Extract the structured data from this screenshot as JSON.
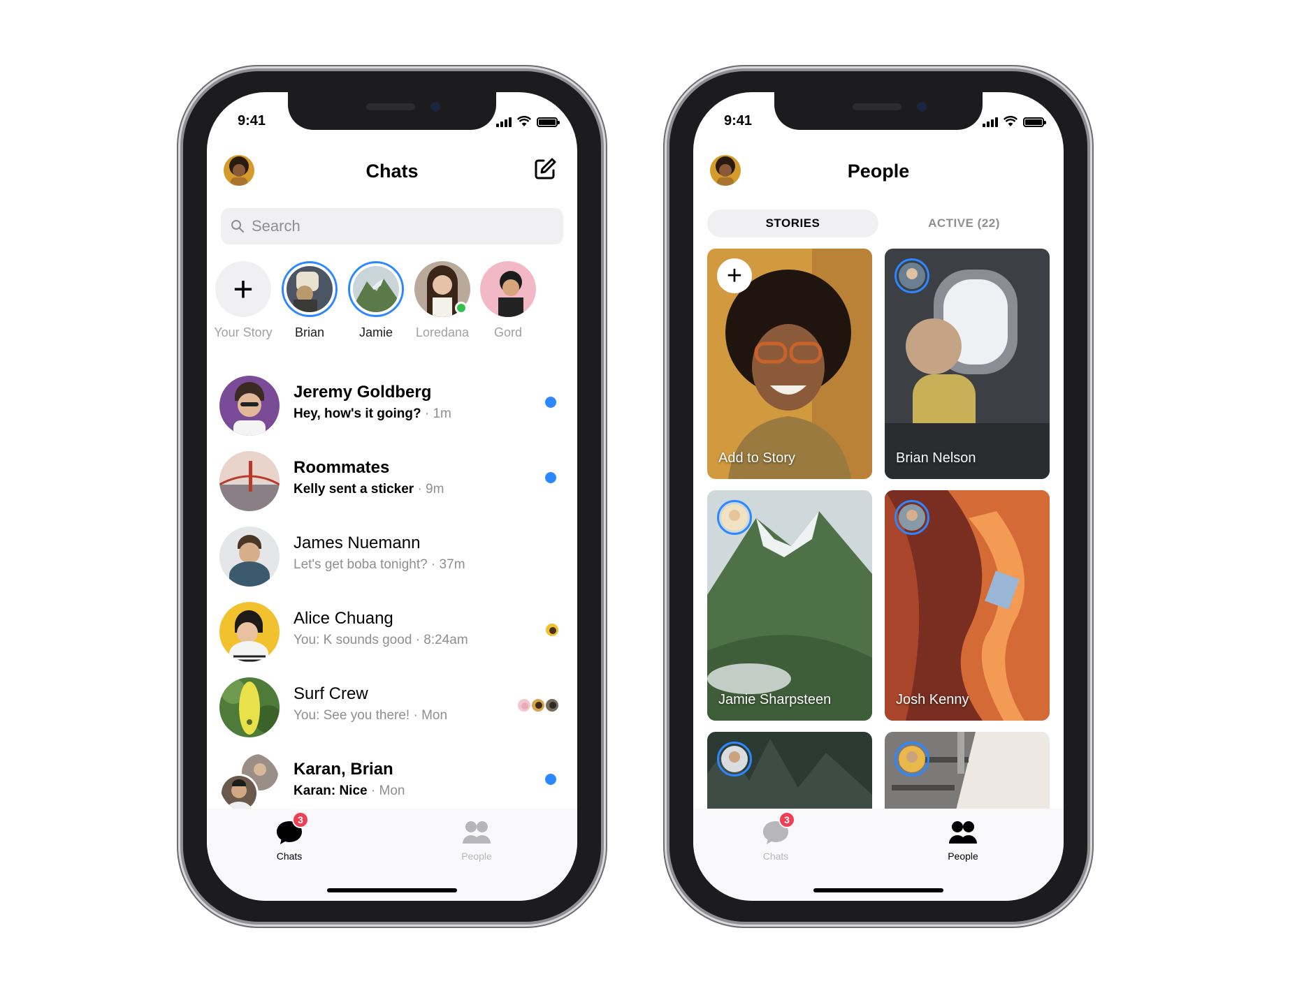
{
  "status": {
    "time": "9:41"
  },
  "colors": {
    "accent": "#2d88ff",
    "badge": "#f03e55",
    "online": "#31c24d"
  },
  "chats_screen": {
    "title": "Chats",
    "search_placeholder": "Search",
    "stories": [
      {
        "label": "Your Story",
        "type": "add"
      },
      {
        "label": "Brian",
        "type": "ring"
      },
      {
        "label": "Jamie",
        "type": "ring"
      },
      {
        "label": "Loredana",
        "type": "online"
      },
      {
        "label": "Gord",
        "type": "plain"
      }
    ],
    "chats": [
      {
        "name": "Jeremy Goldberg",
        "preview": "Hey, how's it going?",
        "time": "· 1m",
        "unread": true
      },
      {
        "name": "Roommates",
        "preview": "Kelly sent a sticker",
        "time": "· 9m",
        "unread": true
      },
      {
        "name": "James Nuemann",
        "preview": "Let's get boba tonight? · 37m",
        "time": "",
        "unread": false
      },
      {
        "name": "Alice Chuang",
        "preview": "You: K sounds good · 8:24am",
        "time": "",
        "unread": false
      },
      {
        "name": "Surf Crew",
        "preview": "You: See you there! · Mon",
        "time": "",
        "unread": false
      },
      {
        "name": "Karan, Brian",
        "preview": "Karan: Nice",
        "time": "· Mon",
        "unread": true
      }
    ],
    "tabs": [
      {
        "label": "Chats",
        "icon": "chat-bubble-icon",
        "badge": "3",
        "active": true
      },
      {
        "label": "People",
        "icon": "people-icon",
        "active": false
      }
    ]
  },
  "people_screen": {
    "title": "People",
    "segments": [
      {
        "label": "STORIES",
        "active": true
      },
      {
        "label": "ACTIVE (22)",
        "active": false
      }
    ],
    "cards": [
      {
        "name": "Add to Story",
        "type": "add"
      },
      {
        "name": "Brian Nelson",
        "type": "story"
      },
      {
        "name": "Jamie Sharpsteen",
        "type": "story"
      },
      {
        "name": "Josh Kenny",
        "type": "story"
      },
      {
        "name": "",
        "type": "story"
      },
      {
        "name": "",
        "type": "story"
      }
    ],
    "tabs": [
      {
        "label": "Chats",
        "icon": "chat-bubble-icon",
        "badge": "3",
        "active": false
      },
      {
        "label": "People",
        "icon": "people-icon",
        "active": true
      }
    ]
  }
}
